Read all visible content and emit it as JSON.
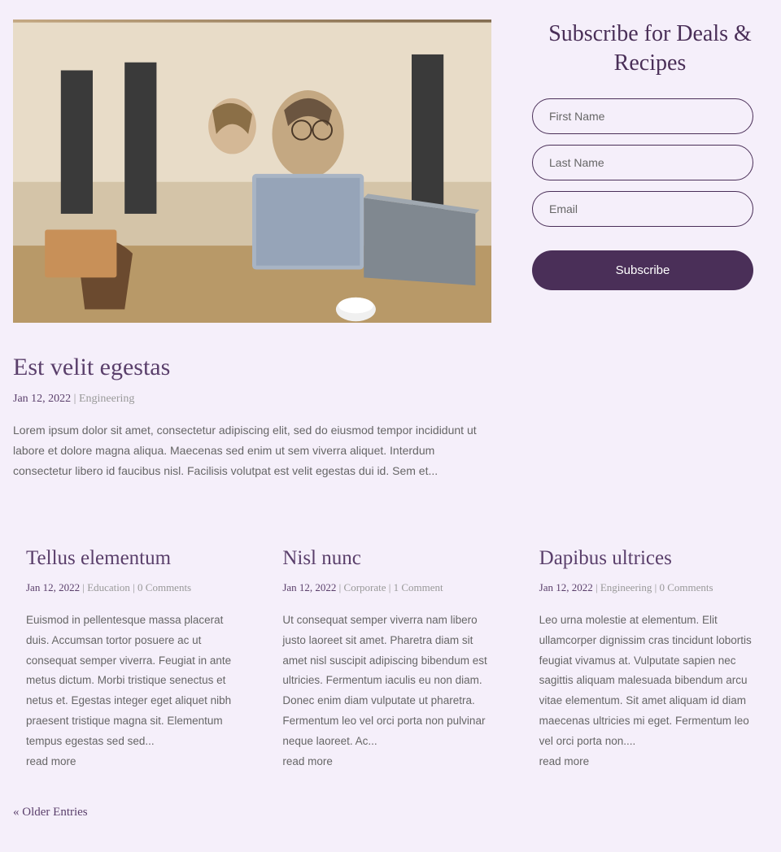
{
  "featured": {
    "title": "Est velit egestas",
    "date": "Jan 12, 2022",
    "category": "Engineering",
    "excerpt": "Lorem ipsum dolor sit amet, consectetur adipiscing elit, sed do eiusmod tempor incididunt ut labore et dolore magna aliqua. Maecenas sed enim ut sem viverra aliquet. Interdum consectetur libero id faucibus nisl. Facilisis volutpat est velit egestas dui id. Sem et..."
  },
  "subscribe": {
    "title": "Subscribe for Deals & Recipes",
    "first_name_placeholder": "First Name",
    "last_name_placeholder": "Last Name",
    "email_placeholder": "Email",
    "button_label": "Subscribe"
  },
  "posts": [
    {
      "title": "Tellus elementum",
      "date": "Jan 12, 2022",
      "category": "Education",
      "comments": "0 Comments",
      "excerpt": "Euismod in pellentesque massa placerat duis. Accumsan tortor posuere ac ut consequat semper viverra. Feugiat in ante metus dictum. Morbi tristique senectus et netus et. Egestas integer eget aliquet nibh praesent tristique magna sit. Elementum tempus egestas sed sed...",
      "read_more": "read more"
    },
    {
      "title": "Nisl nunc",
      "date": "Jan 12, 2022",
      "category": "Corporate",
      "comments": "1 Comment",
      "excerpt": "Ut consequat semper viverra nam libero justo laoreet sit amet. Pharetra diam sit amet nisl suscipit adipiscing bibendum est ultricies. Fermentum iaculis eu non diam. Donec enim diam vulputate ut pharetra. Fermentum leo vel orci porta non pulvinar neque laoreet. Ac...",
      "read_more": "read more"
    },
    {
      "title": "Dapibus ultrices",
      "date": "Jan 12, 2022",
      "category": "Engineering",
      "comments": "0 Comments",
      "excerpt": "Leo urna molestie at elementum. Elit ullamcorper dignissim cras tincidunt lobortis feugiat vivamus at. Vulputate sapien nec sagittis aliquam malesuada bibendum arcu vitae elementum. Sit amet aliquam id diam maecenas ultricies mi eget. Fermentum leo vel orci porta non....",
      "read_more": "read more"
    }
  ],
  "pagination": {
    "older": "« Older Entries"
  }
}
